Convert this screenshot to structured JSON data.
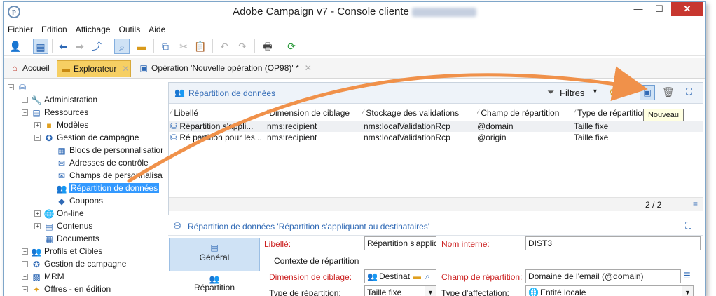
{
  "window": {
    "title": "Adobe Campaign v7 - Console cliente"
  },
  "colors": {
    "accent": "#2f69b5",
    "arrow": "#f0914a",
    "tab_active": "#f6cf63",
    "close": "#c7372f"
  },
  "menu": [
    "Fichier",
    "Edition",
    "Affichage",
    "Outils",
    "Aide"
  ],
  "tabs": [
    {
      "label": "Accueil",
      "icon": "home-icon"
    },
    {
      "label": "Explorateur",
      "icon": "folder-icon"
    },
    {
      "label": "Opération 'Nouvelle opération (OP98)' *",
      "icon": "operation-icon"
    }
  ],
  "tree": [
    {
      "label": "Administration",
      "icon": "wrench-icon"
    },
    {
      "label": "Ressources",
      "icon": "resources-icon"
    },
    {
      "label": "Modèles",
      "icon": "folder-icon"
    },
    {
      "label": "Gestion de campagne",
      "icon": "campaign-icon"
    },
    {
      "label": "Blocs de personnalisation",
      "icon": "blocks-icon"
    },
    {
      "label": "Adresses de contrôle",
      "icon": "control-address-icon"
    },
    {
      "label": "Champs de personnalisation",
      "icon": "fields-icon"
    },
    {
      "label": "Répartition de données",
      "icon": "distribution-icon"
    },
    {
      "label": "Coupons",
      "icon": "coupon-icon"
    },
    {
      "label": "On-line",
      "icon": "globe-icon"
    },
    {
      "label": "Contenus",
      "icon": "content-icon"
    },
    {
      "label": "Documents",
      "icon": "documents-icon"
    },
    {
      "label": "Profils et Cibles",
      "icon": "profiles-icon"
    },
    {
      "label": "Gestion de campagne",
      "icon": "campaign-icon"
    },
    {
      "label": "MRM",
      "icon": "mrm-icon"
    },
    {
      "label": "Offres - en édition",
      "icon": "offers-icon"
    }
  ],
  "list": {
    "title": "Répartition de données",
    "filter_label": "Filtres",
    "tooltip": "Nouveau",
    "columns": [
      "Libellé",
      "Dimension de ciblage",
      "Stockage des validations",
      "Champ de répartition",
      "Type de répartition"
    ],
    "rows": [
      [
        "Répartition s'appli...",
        "nms:recipient",
        "nms:localValidationRcp",
        "@domain",
        "Taille fixe"
      ],
      [
        "Ré partition pour les...",
        "nms:recipient",
        "nms:localValidationRcp",
        "@origin",
        "Taille fixe"
      ]
    ],
    "count": "2 / 2"
  },
  "detail": {
    "title": "Répartition de données 'Répartition s'appliquant au destinataires'",
    "tabs": [
      "Général",
      "Répartition"
    ],
    "libelle_label": "Libellé:",
    "libelle_value": "Répartition s'appliq",
    "internal_name_label": "Nom interne:",
    "internal_name_value": "DIST3",
    "context_title": "Contexte de répartition",
    "dimension_label": "Dimension de ciblage:",
    "dimension_value": "Destinat",
    "field_label": "Champ de répartition:",
    "field_value": "Domaine de l'email (@domain)",
    "type_label": "Type de répartition:",
    "type_value": "Taille fixe",
    "assign_label": "Type d'affectation:",
    "assign_value": "Entité locale"
  }
}
